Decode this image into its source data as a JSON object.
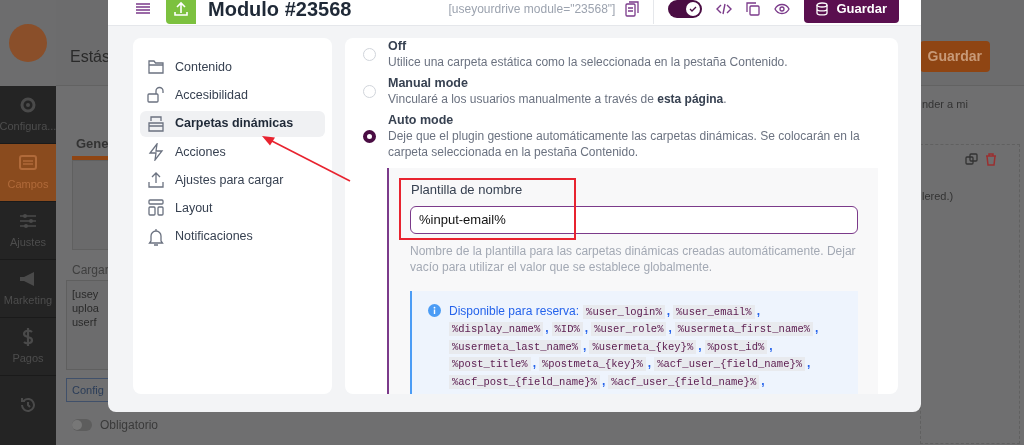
{
  "admin_sidebar": {
    "items": [
      {
        "label": "Configura...",
        "kind": "gear",
        "selected": false
      },
      {
        "label": "Campos",
        "kind": "fields",
        "selected": true
      },
      {
        "label": "Ajustes",
        "kind": "sliders",
        "selected": false
      },
      {
        "label": "Marketing",
        "kind": "megaphone",
        "selected": false
      },
      {
        "label": "Pagos",
        "kind": "dollar",
        "selected": false
      }
    ]
  },
  "admin_topbar": {
    "title": "Estás",
    "save_button": "Guardar"
  },
  "admin_content": {
    "tab": "Gene",
    "upload_label": "Cargar",
    "shortcode_lines": [
      "[usey",
      "uploa",
      "userf"
    ],
    "config_button": "Config",
    "required": {
      "label": "Obligatorio",
      "on": false
    },
    "right_texts": [
      "nder a mi",
      "lered.)"
    ]
  },
  "modal": {
    "title": "Modulo #23568",
    "shortcode": "[useyourdrive module=\"23568\"]",
    "enabled": true,
    "save_button": "Guardar",
    "nav": [
      {
        "label": "Contenido",
        "kind": "folder",
        "selected": false
      },
      {
        "label": "Accesibilidad",
        "kind": "lock",
        "selected": false
      },
      {
        "label": "Carpetas dinámicas",
        "kind": "stack",
        "selected": true
      },
      {
        "label": "Acciones",
        "kind": "bolt",
        "selected": false
      },
      {
        "label": "Ajustes para cargar",
        "kind": "upload",
        "selected": false
      },
      {
        "label": "Layout",
        "kind": "layout",
        "selected": false
      },
      {
        "label": "Notificaciones",
        "kind": "bell",
        "selected": false
      }
    ],
    "options": [
      {
        "title": "Off",
        "description": "Utilice una carpeta estática como la seleccionada en la pestaña Contenido.",
        "selected": false
      },
      {
        "title": "Manual mode",
        "description": "Vincularé a los usuarios manualmente a través de **esta página**.",
        "selected": false
      },
      {
        "title": "Auto mode",
        "description": "Deje que el plugin gestione automáticamente las carpetas dinámicas. Se colocarán en la carpeta seleccionada en la pestaña Contenido.",
        "selected": true
      }
    ],
    "name_template": {
      "label": "Plantilla de nombre",
      "value": "%input-email%",
      "help": "Nombre de la plantilla para las carpetas dinámicas creadas automáticamente. Dejar vacío para utilizar el valor que se establece globalmente."
    },
    "info": {
      "label": "Disponible para reserva:",
      "separator": ",",
      "placeholders": [
        "%user_login%",
        "%user_email%",
        "%display_name%",
        "%ID%",
        "%user_role%",
        "%usermeta_first_name%",
        "%usermeta_last_name%",
        "%usermeta_{key}%",
        "%post_id%",
        "%post_title%",
        "%postmeta_{key}%",
        "%acf_user_{field_name}%",
        "%acf_post_{field_name}%",
        "%acf_user_{field_name}%"
      ]
    }
  }
}
